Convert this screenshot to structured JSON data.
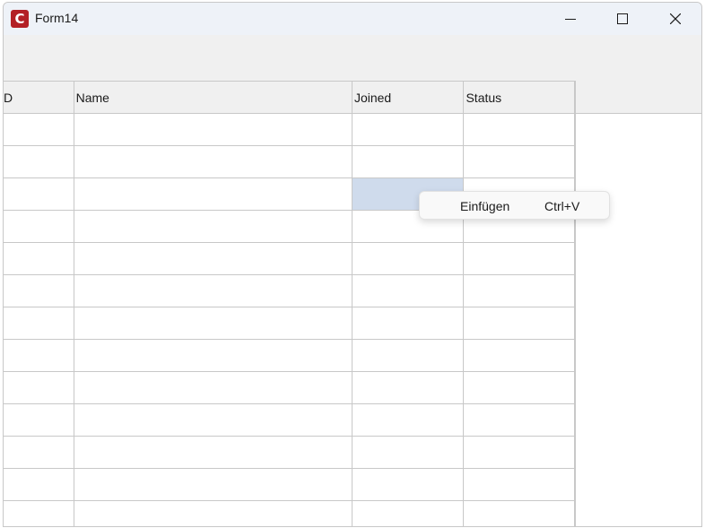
{
  "window": {
    "title": "Form14",
    "app_icon_letter": "C",
    "accent_color": "#b32025"
  },
  "grid": {
    "columns": [
      {
        "label": "D"
      },
      {
        "label": "Name"
      },
      {
        "label": "Joined"
      },
      {
        "label": "Status"
      }
    ],
    "row_count": 13,
    "selected_cell": {
      "row": 2,
      "column": 2
    },
    "selection_color": "#cfdbec"
  },
  "context_menu": {
    "items": [
      {
        "label": "Einfügen",
        "shortcut": "Ctrl+V"
      }
    ]
  },
  "icons": {
    "minimize": "minimize-icon",
    "maximize": "maximize-icon",
    "close": "close-icon"
  }
}
